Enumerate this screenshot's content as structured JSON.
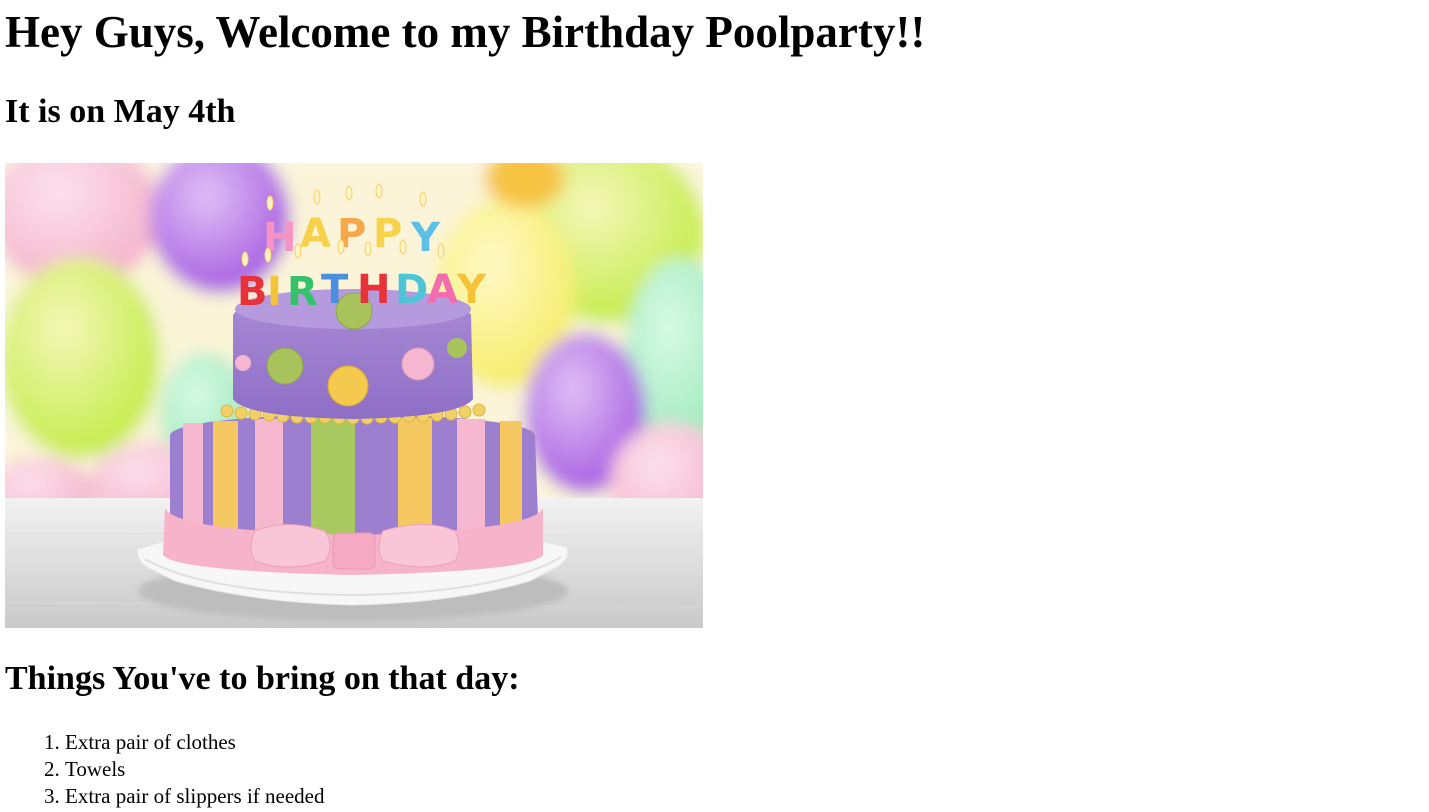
{
  "page": {
    "title": "Hey Guys, Welcome to my Birthday Poolparty!!",
    "date_heading": "It is on May 4th",
    "image": {
      "description_icon": "birthday-cake-image",
      "candle_text": "HAPPY BIRTHDAY"
    },
    "bring_heading": "Things You've to bring on that day:",
    "bring_list": [
      "Extra pair of clothes",
      "Towels",
      "Extra pair of slippers if needed"
    ]
  },
  "colors": {
    "text": "#000000",
    "background": "#ffffff"
  }
}
